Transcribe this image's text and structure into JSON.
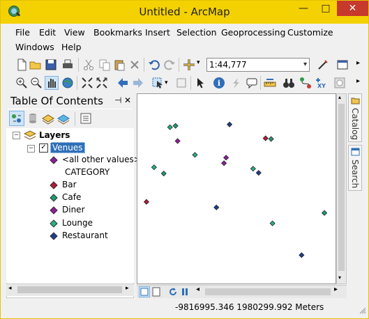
{
  "window": {
    "title": "Untitled - ArcMap",
    "minimize_glyph": "—",
    "maximize_glyph": "□",
    "close_glyph": "✕"
  },
  "menu": [
    "File",
    "Edit",
    "View",
    "Bookmarks",
    "Insert",
    "Selection",
    "Geoprocessing",
    "Customize",
    "Windows",
    "Help"
  ],
  "toolbar": {
    "scale_value": "1:44,777",
    "scale_dropdown_glyph": "▾"
  },
  "toc": {
    "title": "Table Of Contents",
    "pin_glyph": "⊣",
    "close_glyph": "✕",
    "group_label": "Layers",
    "layer_label": "Venues",
    "other_values_label": "<all other values>",
    "field_header": "CATEGORY",
    "legend": [
      {
        "label": "Bar",
        "color": "#b01c3a"
      },
      {
        "label": "Cafe",
        "color": "#1e9a6e"
      },
      {
        "label": "Diner",
        "color": "#8e1f9a"
      },
      {
        "label": "Lounge",
        "color": "#28b07f"
      },
      {
        "label": "Restaurant",
        "color": "#1d3f8c"
      }
    ],
    "other_values_color": "#8e1f9a"
  },
  "map_points": [
    {
      "category": "Lounge"
    },
    {
      "category": "Cafe"
    },
    {
      "category": "Restaurant"
    },
    {
      "category": "Diner"
    },
    {
      "category": "Bar"
    },
    {
      "category": "Cafe"
    },
    {
      "category": "Lounge"
    },
    {
      "category": "Diner"
    },
    {
      "category": "Diner"
    },
    {
      "category": "Lounge"
    },
    {
      "category": "Cafe"
    },
    {
      "category": "Lounge"
    },
    {
      "category": "Restaurant"
    },
    {
      "category": "Bar"
    },
    {
      "category": "Restaurant"
    },
    {
      "category": "Cafe"
    },
    {
      "category": "Lounge"
    },
    {
      "category": "Restaurant"
    }
  ],
  "sidebar_tabs": [
    "Catalog",
    "Search"
  ],
  "status": {
    "coordinates": "-9816995.346  1980299.992 Meters"
  },
  "colors": {
    "title_bar": "#f4d100",
    "close_button": "#c7392c"
  },
  "icons": {
    "app": "arcmap-globe-icon",
    "standard_toolbar": [
      "new-document-icon",
      "open-folder-icon",
      "save-icon",
      "print-icon",
      "cut-icon",
      "copy-icon",
      "paste-icon",
      "delete-icon",
      "undo-icon",
      "redo-icon",
      "add-data-icon"
    ],
    "tools_toolbar": [
      "zoom-in-icon",
      "zoom-out-icon",
      "pan-icon",
      "full-extent-icon",
      "fixed-zoom-in-icon",
      "fixed-zoom-out-icon",
      "back-extent-icon",
      "forward-extent-icon",
      "select-features-icon",
      "clear-selection-icon",
      "select-elements-icon",
      "identify-icon",
      "hyperlink-icon",
      "html-popup-icon",
      "measure-icon",
      "find-icon",
      "find-route-icon",
      "go-to-xy-icon",
      "time-slider-icon"
    ]
  }
}
